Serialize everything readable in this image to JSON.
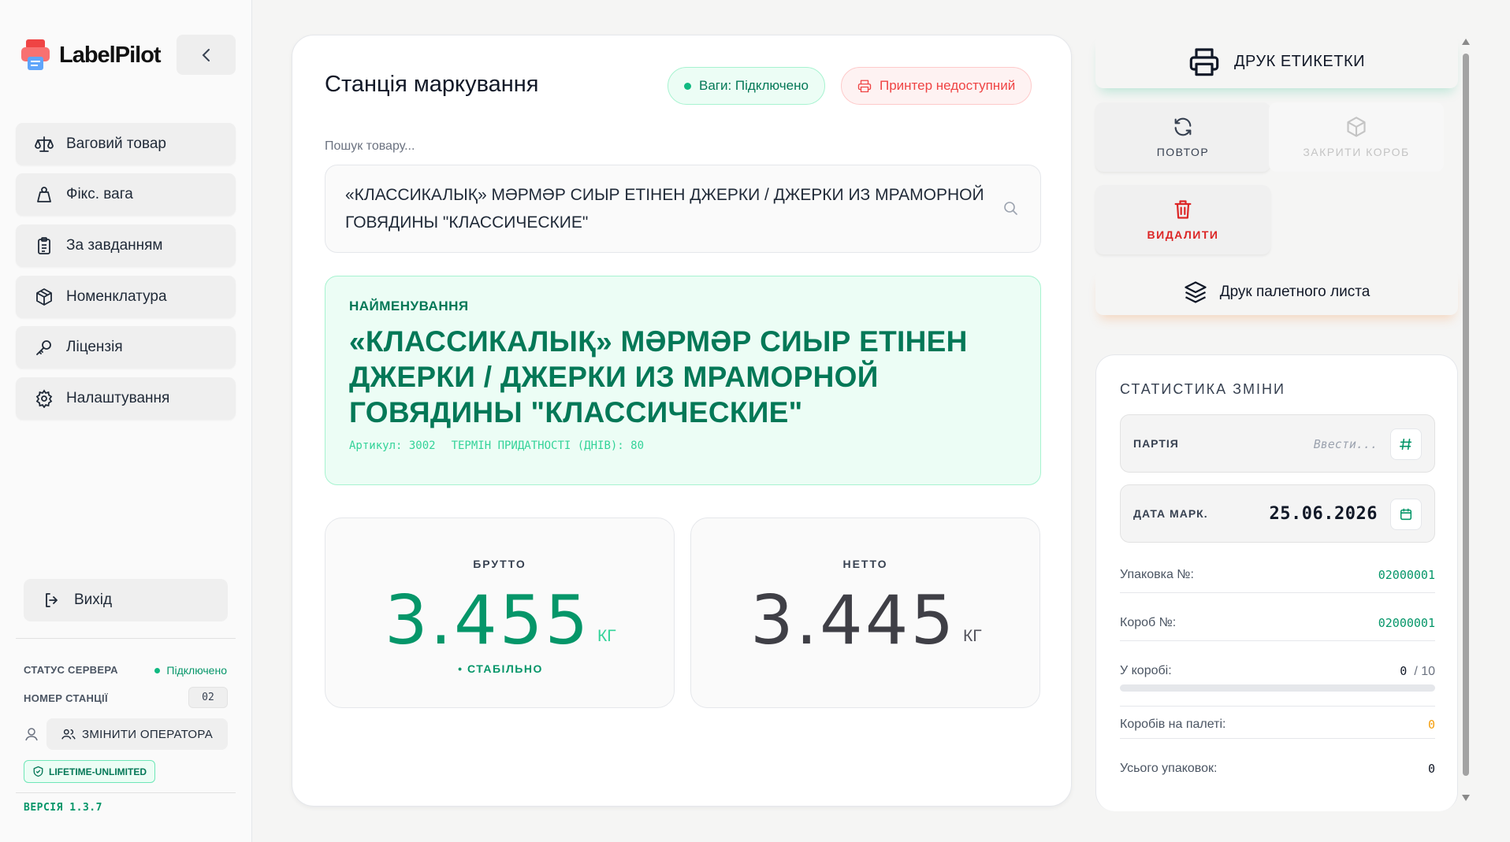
{
  "app": {
    "name": "LabelPilot"
  },
  "sidebar": {
    "items": [
      {
        "label": "Ваговий товар",
        "icon": "scale-icon"
      },
      {
        "label": "Фікс. вага",
        "icon": "weight-icon"
      },
      {
        "label": "За завданням",
        "icon": "clipboard-icon"
      },
      {
        "label": "Номенклатура",
        "icon": "box-icon"
      },
      {
        "label": "Ліцензія",
        "icon": "key-icon"
      },
      {
        "label": "Налаштування",
        "icon": "gear-icon"
      }
    ],
    "logout_label": "Вихід",
    "server_status_label": "СТАТУС СЕРВЕРА",
    "server_status_value": "Підключено",
    "station_number_label": "НОМЕР СТАНЦІЇ",
    "station_number_value": "02",
    "change_operator_label": "ЗМІНИТИ ОПЕРАТОРА",
    "license_label": "LIFETIME-UNLIMITED",
    "version": "ВЕРСІЯ 1.3.7"
  },
  "main": {
    "title": "Станція маркування",
    "scale_status": "Ваги: Підключено",
    "printer_status": "Принтер недоступний",
    "search_label": "Пошук товару...",
    "search_value": "«КЛАССИКАЛЫҚ» МӘРМӘР СИЫР ЕТІНЕН ДЖЕРКИ / ДЖЕРКИ ИЗ МРАМОРНОЙ ГОВЯДИНЫ \"КЛАССИЧЕСКИЕ\"",
    "name_label": "НАЙМЕНУВАННЯ",
    "name_value": "«КЛАССИКАЛЫҚ» МӘРМӘР СИЫР ЕТІНЕН ДЖЕРКИ / ДЖЕРКИ ИЗ МРАМОРНОЙ ГОВЯДИНЫ \"КЛАССИЧЕСКИЕ\"",
    "article": "Артикул: 3002",
    "shelf_life": "ТЕРМІН ПРИДАТНОСТІ (ДНІВ): 80",
    "gross_label": "БРУТТО",
    "gross_value": "3.455",
    "gross_unit": "КГ",
    "stable_label": "• СТАБІЛЬНО",
    "net_label": "НЕТТО",
    "net_value": "3.445",
    "net_unit": "КГ"
  },
  "actions": {
    "print_label": "ДРУК ЕТИКЕТКИ",
    "repeat": "ПОВТОР",
    "close_box": "ЗАКРИТИ КОРОБ",
    "delete": "ВИДАЛИТИ",
    "print_pallet": "Друк палетного листа"
  },
  "stats": {
    "title": "СТАТИСТИКА ЗМІНИ",
    "batch_label": "ПАРТІЯ",
    "batch_placeholder": "Ввести...",
    "date_label": "ДАТА МАРК.",
    "date_value": "25.06.2026",
    "package_label": "Упаковка №:",
    "package_value": "02000001",
    "box_label": "Короб №:",
    "box_value": "02000001",
    "in_box_label": "У коробі:",
    "in_box_value": "0",
    "in_box_max": "/ 10",
    "in_box_fraction": 0,
    "boxes_on_pallet_label": "Коробів на палеті:",
    "boxes_on_pallet_value": "0",
    "total_packages_label": "Усього упаковок:",
    "total_packages_value": "0"
  },
  "colors": {
    "accent": "#059669",
    "accent_light": "#ecfdf5",
    "danger": "#ef4444",
    "warning": "#f59e0b"
  }
}
